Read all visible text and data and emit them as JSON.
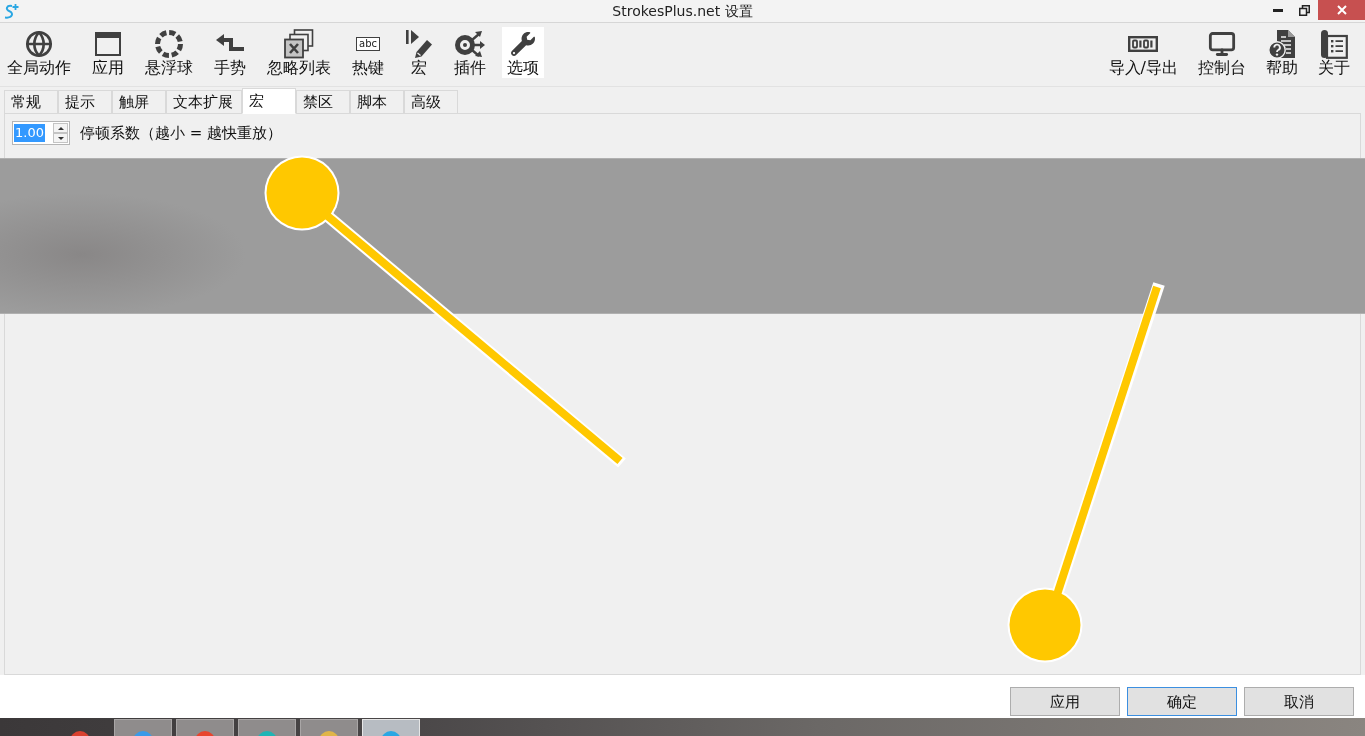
{
  "window": {
    "title": "StrokesPlus.net 设置"
  },
  "toolbar": {
    "left": [
      {
        "label": "全局动作",
        "selected": false
      },
      {
        "label": "应用",
        "selected": false
      },
      {
        "label": "悬浮球",
        "selected": false
      },
      {
        "label": "手势",
        "selected": false
      },
      {
        "label": "忽略列表",
        "selected": false
      },
      {
        "label": "热键",
        "selected": false,
        "icon_text": "abc"
      },
      {
        "label": "宏",
        "selected": false
      },
      {
        "label": "插件",
        "selected": false
      },
      {
        "label": "选项",
        "selected": true
      }
    ],
    "right": [
      {
        "label": "导入/导出"
      },
      {
        "label": "控制台"
      },
      {
        "label": "帮助"
      },
      {
        "label": "关于"
      }
    ]
  },
  "tabs": [
    {
      "label": "常规",
      "selected": false
    },
    {
      "label": "提示",
      "selected": false
    },
    {
      "label": "触屏",
      "selected": false
    },
    {
      "label": "文本扩展",
      "selected": false
    },
    {
      "label": "宏",
      "selected": true
    },
    {
      "label": "禁区",
      "selected": false
    },
    {
      "label": "脚本",
      "selected": false
    },
    {
      "label": "高级",
      "selected": false
    }
  ],
  "settings": [
    {
      "kind": "spinbox",
      "value": "1.00",
      "value_selected": true,
      "label": "停顿系数（越小 = 越快重放）"
    }
  ],
  "dialog_buttons": [
    {
      "label": "应用",
      "focused": false
    },
    {
      "label": "确定",
      "focused": true
    },
    {
      "label": "取消",
      "focused": false
    }
  ],
  "taskbar": [
    {
      "selected": false
    },
    {
      "selected": false
    },
    {
      "selected": false
    },
    {
      "selected": false
    },
    {
      "selected": true
    }
  ]
}
